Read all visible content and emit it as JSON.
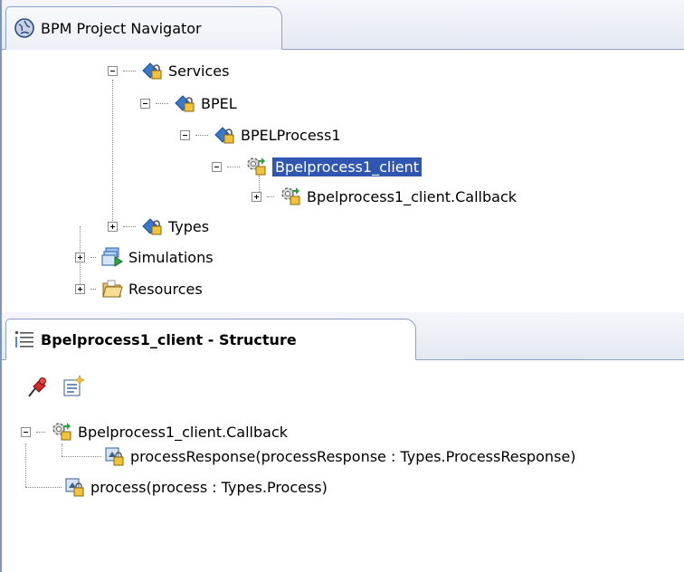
{
  "navigator": {
    "tab_title": "BPM Project Navigator",
    "tree": [
      {
        "label": "Services"
      },
      {
        "label": "BPEL"
      },
      {
        "label": "BPELProcess1"
      },
      {
        "label": "Bpelprocess1_client"
      },
      {
        "label": "Bpelprocess1_client.Callback"
      },
      {
        "label": "Types"
      },
      {
        "label": "Simulations"
      },
      {
        "label": "Resources"
      }
    ]
  },
  "structure": {
    "tab_title": "Bpelprocess1_client - Structure",
    "tree": [
      {
        "label": "Bpelprocess1_client.Callback"
      },
      {
        "label": "processResponse(processResponse : Types.ProcessResponse)"
      },
      {
        "label": "process(process : Types.Process)"
      }
    ]
  },
  "colors": {
    "selection": "#2f56b0",
    "tab_border": "#8da2c0"
  }
}
